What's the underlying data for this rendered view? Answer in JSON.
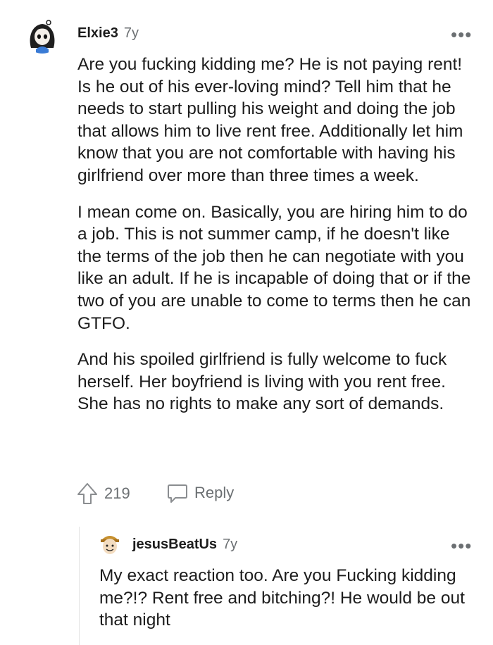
{
  "comment": {
    "username": "Elxie3",
    "age": "7y",
    "paragraphs": [
      "Are you fucking kidding me? He is not paying rent! Is he out of his ever-loving mind? Tell him that he needs to start pulling his weight and doing the job that allows him to live rent free. Additionally let him know that you are not comfortable with having his girlfriend over more than three times a week.",
      "I mean come on. Basically, you are hiring him to do a job. This is not summer camp, if he doesn't like the terms of the job then he can negotiate with you like an adult. If he is incapable of doing that or if the two of you are unable to come to terms then he can GTFO.",
      "And his spoiled girlfriend is fully welcome to fuck herself. Her boyfriend is living with you rent free. She has no rights to make any sort of demands."
    ],
    "upvotes": "219",
    "reply_label": "Reply",
    "more_label": "•••"
  },
  "reply": {
    "username": "jesusBeatUs",
    "age": "7y",
    "text": "My exact reaction too. Are you Fucking kidding me?!? Rent free and bitching?! He would be out that night",
    "more_label": "•••"
  },
  "icons": {
    "upvote": "upvote-arrow-icon",
    "reply": "speech-bubble-icon",
    "more": "more-options-icon"
  },
  "colors": {
    "text": "#1c1c1c",
    "meta": "#6b6f72",
    "avatar1_bg": "#2a2a2a",
    "avatar1_accent": "#3a7bd5",
    "avatar2_bg": "#e8c48a"
  }
}
